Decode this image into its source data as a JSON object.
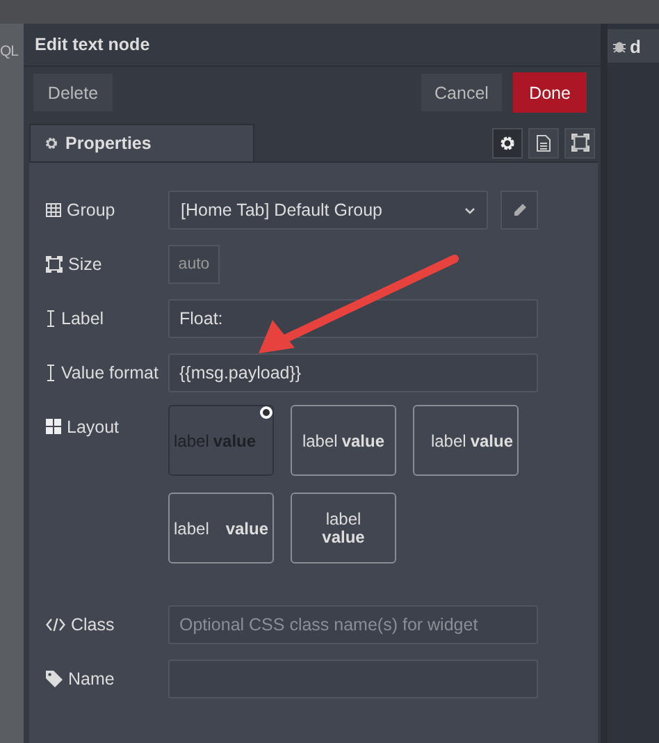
{
  "left_strip": {
    "text": "QL"
  },
  "dialog": {
    "title": "Edit text node",
    "buttons": [
      {
        "label": "Delete",
        "kind": "plain"
      },
      {
        "label": "Cancel",
        "kind": "plain"
      },
      {
        "label": "Done",
        "kind": "primary"
      }
    ],
    "tabs": [
      {
        "label": "Properties",
        "selected": true
      }
    ],
    "tool_tabs": [
      {
        "kind": "gear",
        "selected": true
      },
      {
        "kind": "document",
        "selected": false
      },
      {
        "kind": "frame",
        "selected": false
      }
    ],
    "fields": [
      {
        "kind": "group",
        "label": "Group",
        "value": "[Home Tab] Default Group"
      },
      {
        "kind": "size",
        "label": "Size",
        "value": "auto"
      },
      {
        "kind": "label",
        "label": "Label",
        "value": "Float:"
      },
      {
        "kind": "format",
        "label": "Value format",
        "value": "{{msg.payload}}"
      },
      {
        "kind": "layout",
        "label": "Layout",
        "options": [
          {
            "kind": "left",
            "label": "label",
            "value": "value",
            "selected": true
          },
          {
            "kind": "center",
            "label": "label",
            "value": "value",
            "selected": false
          },
          {
            "kind": "right",
            "label": "label",
            "value": "value",
            "selected": false
          },
          {
            "kind": "spread",
            "label": "label",
            "value": "value",
            "selected": false
          },
          {
            "kind": "stacked",
            "label": "label",
            "value": "value",
            "selected": false
          }
        ]
      },
      {
        "kind": "class",
        "label": "Class",
        "placeholder": "Optional CSS class name(s) for widget"
      },
      {
        "kind": "name",
        "label": "Name"
      }
    ]
  },
  "right_strip": {
    "tab_text": "d"
  }
}
